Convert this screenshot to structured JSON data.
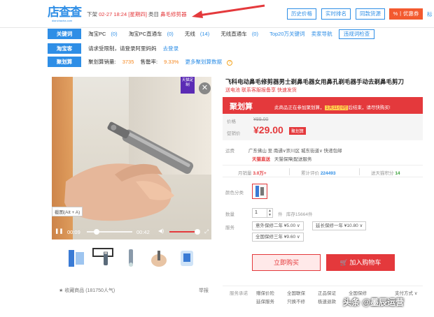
{
  "header": {
    "logo_text": "店查查",
    "logo_sub": "dianchacha.com",
    "shelf_label": "下架",
    "shelf_date": "02-27 18:24",
    "shelf_day": "[星期四]",
    "category_label": "类目",
    "category_value": "鼻毛修剪器",
    "buttons": [
      "历史价格",
      "实时排名",
      "同款货源"
    ],
    "coupon_button": "%丨优惠券",
    "extra": "标"
  },
  "keyword_row": {
    "tag": "关键词",
    "items": [
      {
        "label": "淘宝PC",
        "count": "(0)"
      },
      {
        "label": "淘宝PC直通车",
        "count": "(0)"
      },
      {
        "label": "无线",
        "count": "(14)"
      },
      {
        "label": "无线直通车",
        "count": "(0)"
      },
      {
        "label": "Top20万关键词",
        "count": ""
      },
      {
        "label": "卖家导航",
        "count": ""
      }
    ],
    "button": "违规词检查"
  },
  "taoke_row": {
    "tag": "淘宝客",
    "text": "请求受限制，请登录阿里妈妈",
    "link": "去登录"
  },
  "juhuasuan_row": {
    "tag": "聚划算",
    "sales_label": "聚划算销量:",
    "sales_value": "3735",
    "rate_label": "售罄率:",
    "rate_value": "9.33%",
    "more": "更多聚划算数据"
  },
  "media": {
    "corner_badge": "天猫定制",
    "shortcut": "截图(Alt + A)",
    "time_current": "00:09",
    "time_total": "00:42",
    "progress": 0.21,
    "volume": 0.9
  },
  "product": {
    "title": "飞科电动鼻毛修剪器男士剃鼻毛器女用鼻孔剃毛器手动去剃鼻毛剪刀",
    "subtitle": "送电池 联系客服报备享 快速发货",
    "jhs_logo": "聚划算",
    "jhs_text_pre": "此商品正在参加聚划算，",
    "jhs_highlight": "1天11小时",
    "jhs_text_post": "后结束，请尽快购买!",
    "price_label": "价格",
    "original_price": "¥89.00",
    "promo_label": "促销价",
    "current_price": "¥29.00",
    "promo_tag": "聚划算"
  },
  "shipping": {
    "label": "运费",
    "text": "广东佛山 至 南通∨崇川区 城东街道∨ 快递包邮",
    "tmall_tag": "天猫直送",
    "service": "天猫保障|配送服务"
  },
  "stats": {
    "monthly_label": "月销量",
    "monthly_value": "3.0万+",
    "reviews_label": "累计评价",
    "reviews_value": "224493",
    "points_label": "送天猫积分",
    "points_value": "14"
  },
  "options": {
    "color_label": "颜色分类",
    "qty_label": "数量",
    "qty_value": "1",
    "unit": "件",
    "stock": "库存15664件",
    "service_label": "服务",
    "services": [
      "意外保修二年 ¥5.00 ∨",
      "延长保修一年 ¥10.80 ∨",
      "全国保修三年 ¥9.60 ∨"
    ]
  },
  "actions": {
    "buy": "立即购买",
    "cart": "加入购物车"
  },
  "footer": {
    "fav": "收藏商品",
    "fav_count": "(181750人气)",
    "report": "举报",
    "promise_label": "服务承诺",
    "promises_row1": [
      "赠保价险",
      "全国联保",
      "正品保证",
      "全国保修"
    ],
    "promises_row2": [
      "延保服务",
      "只换不修",
      "极速退款"
    ],
    "payment": "支付方式 ∨"
  },
  "watermark": "头条 @墨辰运营"
}
